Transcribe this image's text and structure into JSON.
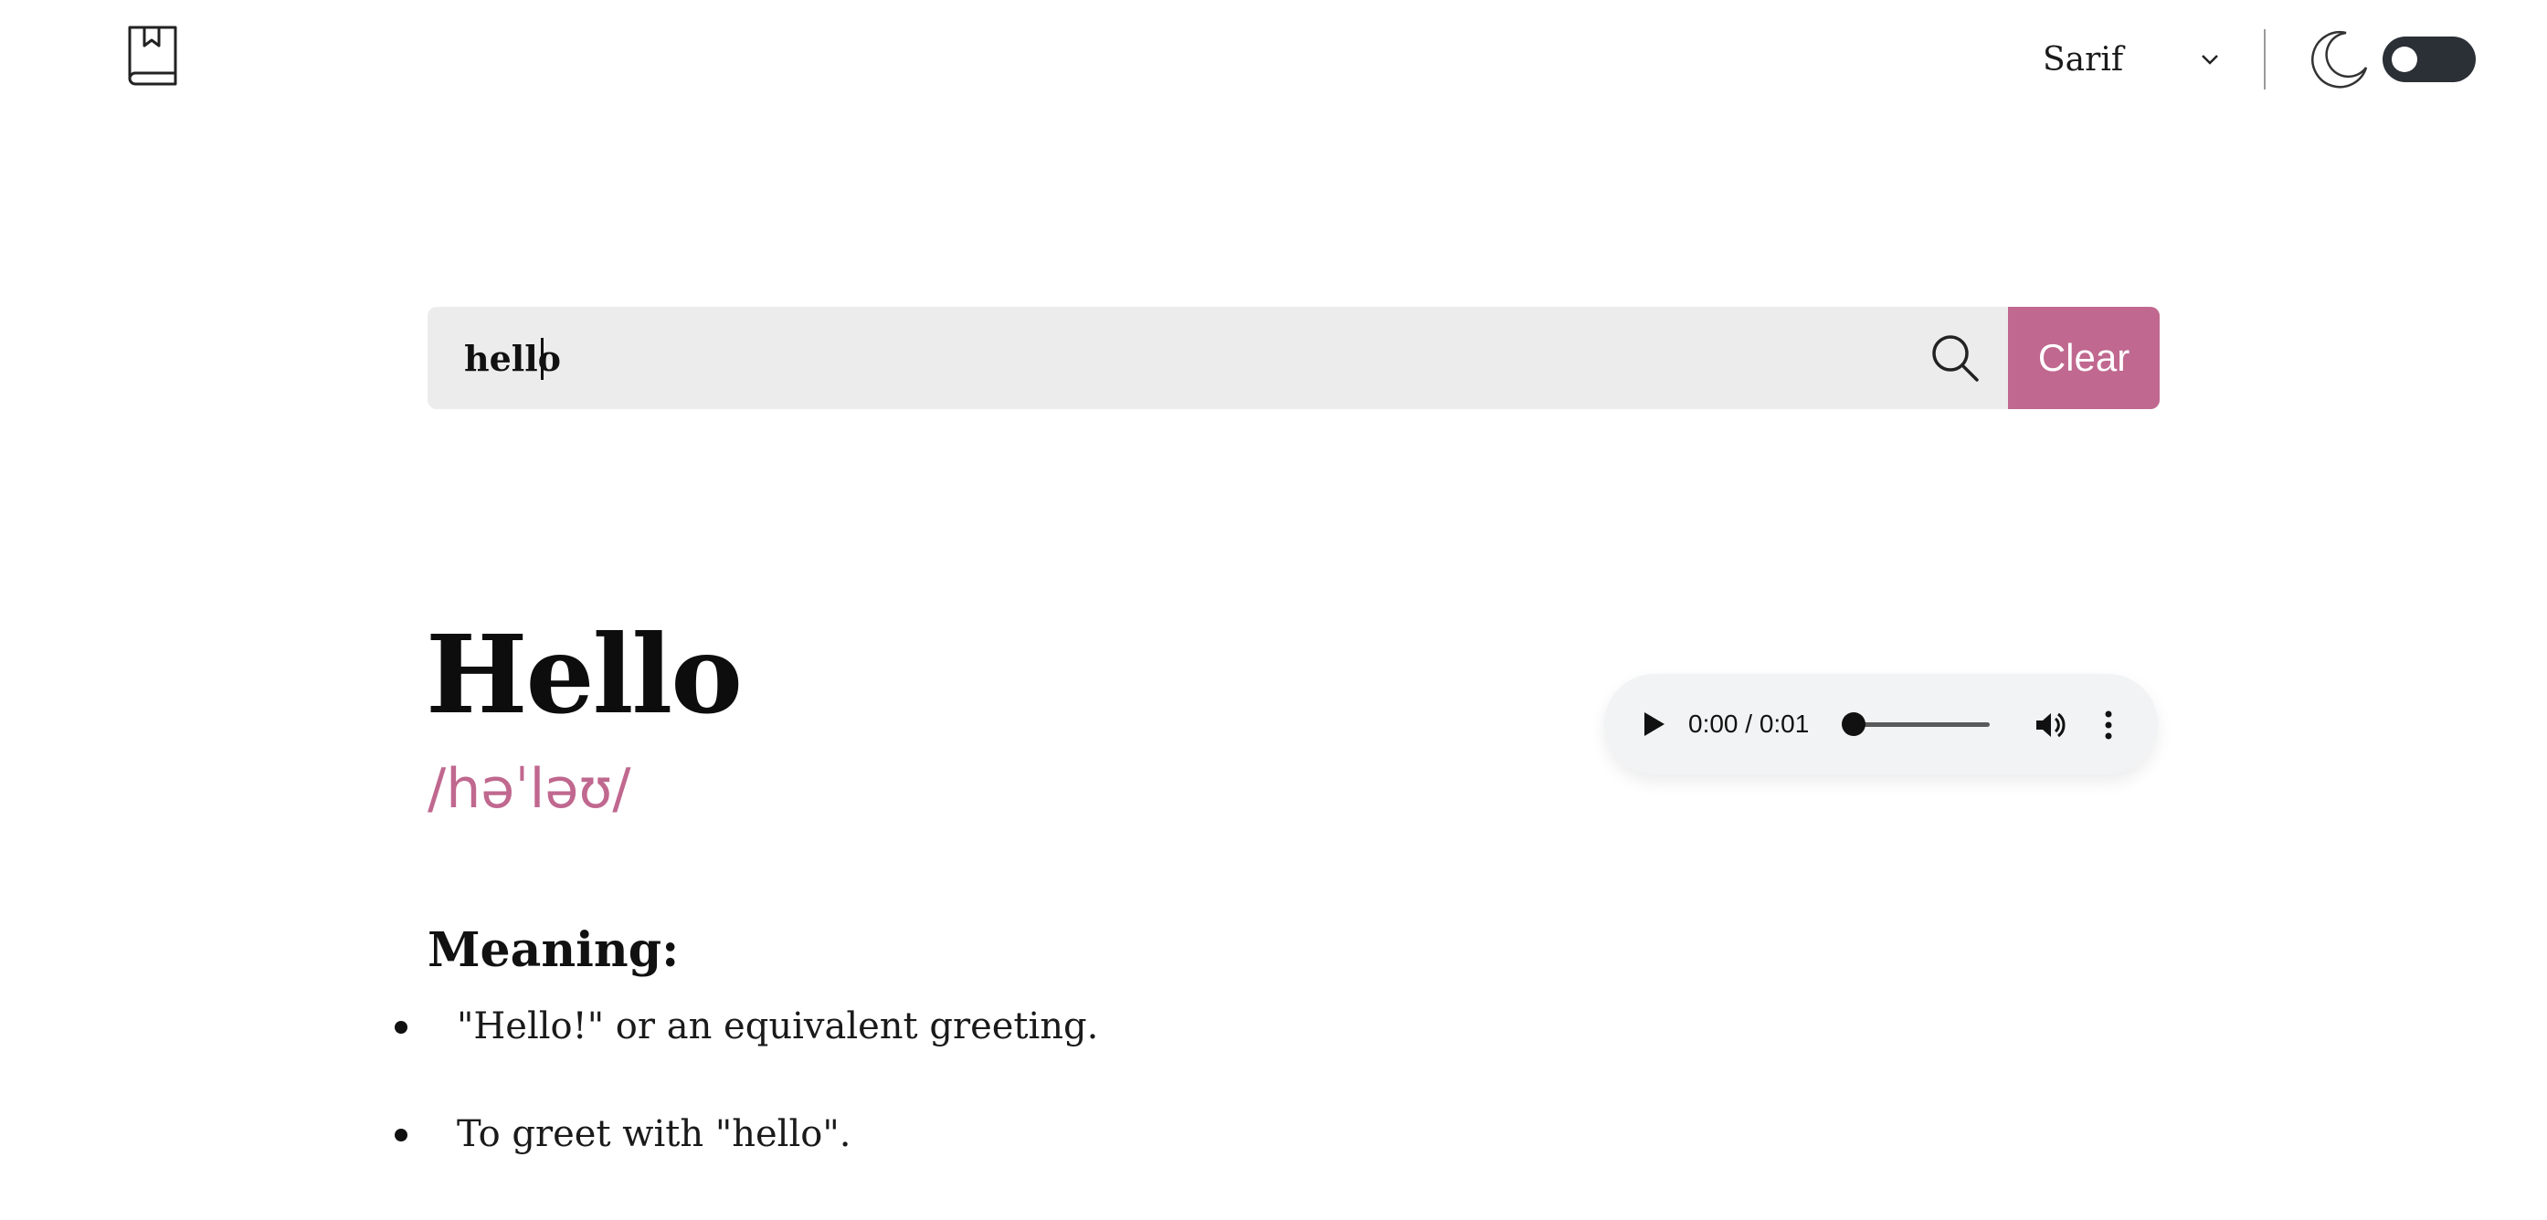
{
  "header": {
    "logo_icon": "book-bookmark-icon",
    "font_selector": {
      "selected": "Sarif",
      "icon": "chevron-down-icon"
    },
    "theme_icon": "moon-icon",
    "dark_mode_toggle": {
      "on": false
    }
  },
  "search": {
    "value": "hello",
    "search_icon": "search-icon",
    "clear_label": "Clear"
  },
  "entry": {
    "word": "Hello",
    "phonetic": "/həˈləʊ/"
  },
  "audio_player": {
    "time": "0:00 / 0:01",
    "progress": 0,
    "icons": [
      "play-icon",
      "volume-icon",
      "more-vertical-icon"
    ]
  },
  "meaning": {
    "heading": "Meaning:",
    "items": [
      "\"Hello!\" or an equivalent greeting.",
      "To greet with \"hello\"."
    ]
  },
  "colors": {
    "accent": "#c0688f",
    "search_bg": "#ececec",
    "toggle_bg": "#2b2f36",
    "player_bg": "#f1f3f4"
  }
}
